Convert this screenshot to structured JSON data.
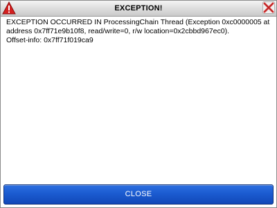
{
  "window": {
    "title": "EXCEPTION!"
  },
  "message": {
    "text": "EXCEPTION OCCURRED IN ProcessingChain Thread (Exception 0xc0000005 at address 0x7ff71e9b10f8, read/write=0, r/w location=0x2cbbd967ec0).\nOffset-info: 0x7ff71f019ca9"
  },
  "buttons": {
    "close_label": "CLOSE"
  },
  "icons": {
    "warning": "warning-icon",
    "close": "close-icon"
  },
  "colors": {
    "warning_red": "#d42020",
    "button_blue": "#1b5bd0",
    "close_x_red": "#e04040"
  }
}
